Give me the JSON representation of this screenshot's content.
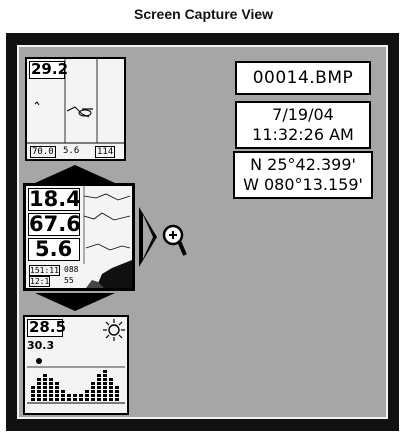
{
  "header": {
    "title": "Screen Capture View"
  },
  "info": {
    "filename": "00014.BMP",
    "date": "7/19/04",
    "time": "11:32:26 AM",
    "lat": "N 25°42.399'",
    "lon": "W 080°13.159'"
  },
  "thumbnails": [
    {
      "name": "map-view",
      "depth": "29.2",
      "footer": [
        "70.0",
        "5.6",
        "114"
      ]
    },
    {
      "name": "sonar-view",
      "readings": [
        "18.4",
        "67.6",
        "5.6"
      ],
      "footer": [
        "151:11",
        "088",
        "12:1",
        "55"
      ]
    },
    {
      "name": "stats-view",
      "reading1": "28.5",
      "reading2": "30.3"
    }
  ],
  "icons": [
    "arrow-up-icon",
    "arrow-down-icon",
    "arrow-right-icon",
    "zoom-in-icon",
    "sun-icon"
  ]
}
